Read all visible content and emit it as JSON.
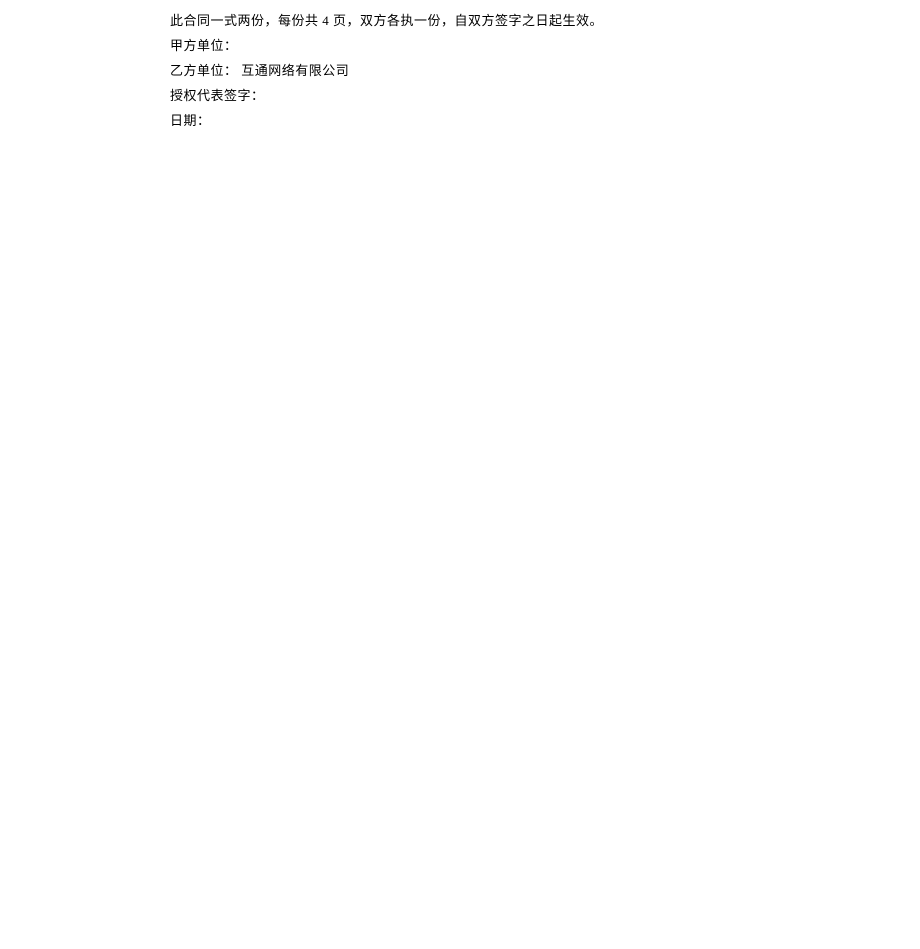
{
  "lines": {
    "line1_part1": "此合同一式两份，每份共 ",
    "line1_num": "4",
    "line1_part2": " 页，双方各执一份，自双方签字之日起生效。",
    "line2": "甲方单位：",
    "line3": "乙方单位：   互通网络有限公司",
    "line4": "授权代表签字：",
    "line5": "日期："
  }
}
